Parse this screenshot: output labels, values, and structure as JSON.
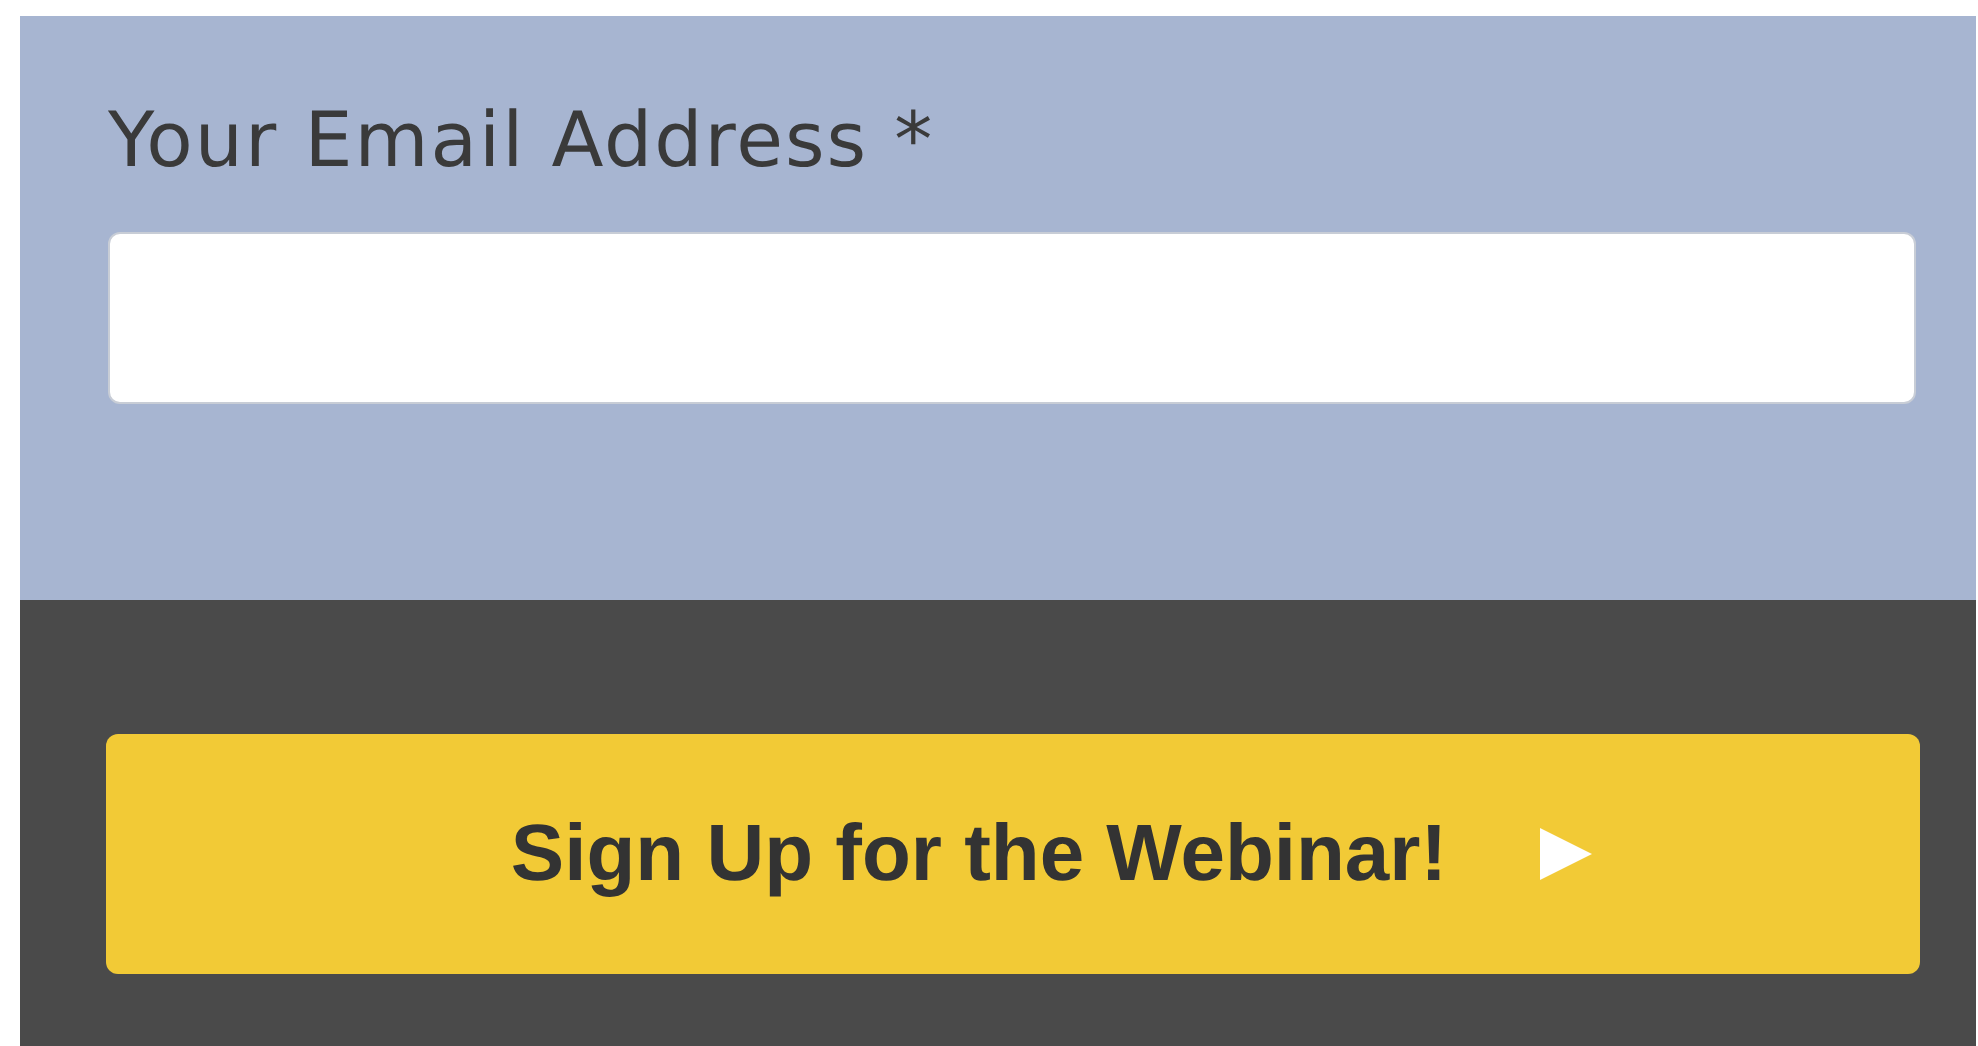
{
  "email_field": {
    "label": "Your Email Address *"
  },
  "submit_button": {
    "label": "Sign Up for the Webinar!"
  }
}
